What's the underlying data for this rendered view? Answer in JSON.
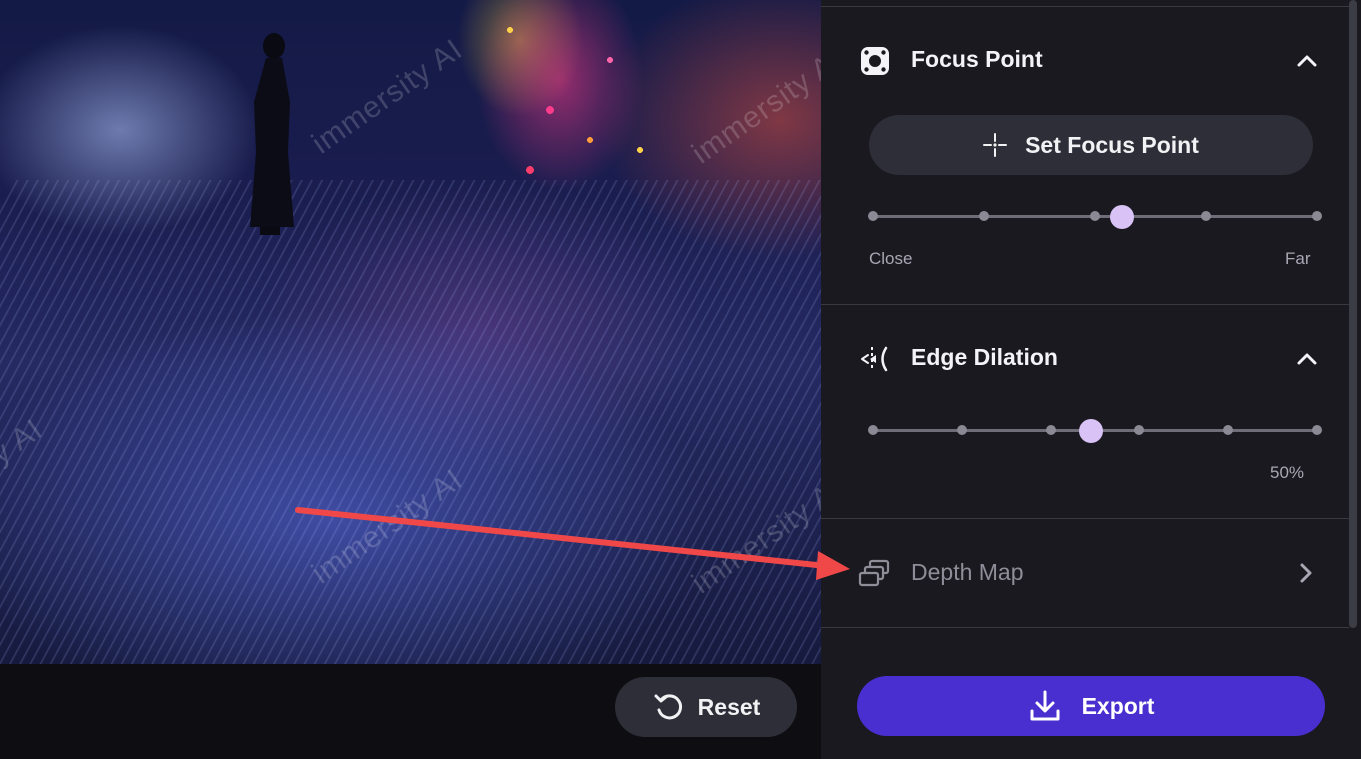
{
  "preview": {
    "watermark": "immersity AI"
  },
  "reset_button": {
    "label": "Reset",
    "icon": "undo-icon"
  },
  "focus_point": {
    "title": "Focus Point",
    "icon": "focus-target-icon",
    "set_button_label": "Set Focus Point",
    "set_button_icon": "crosshair-icon",
    "slider": {
      "stops": 5,
      "value_index": 2.25,
      "min_label": "Close",
      "max_label": "Far"
    },
    "expanded": true
  },
  "edge_dilation": {
    "title": "Edge Dilation",
    "icon": "edge-dilation-icon",
    "slider": {
      "stops": 6,
      "value_percent": 50,
      "value_label": "50%"
    },
    "expanded": true
  },
  "depth_map": {
    "title": "Depth Map",
    "icon": "layers-icon",
    "expanded": false
  },
  "export_button": {
    "label": "Export",
    "icon": "download-icon"
  },
  "colors": {
    "panel_bg": "#1a1920",
    "button_bg": "#2e2e38",
    "accent": "#4a2fd0",
    "slider_thumb": "#d8c2f6",
    "annotation_arrow": "#f04848"
  }
}
